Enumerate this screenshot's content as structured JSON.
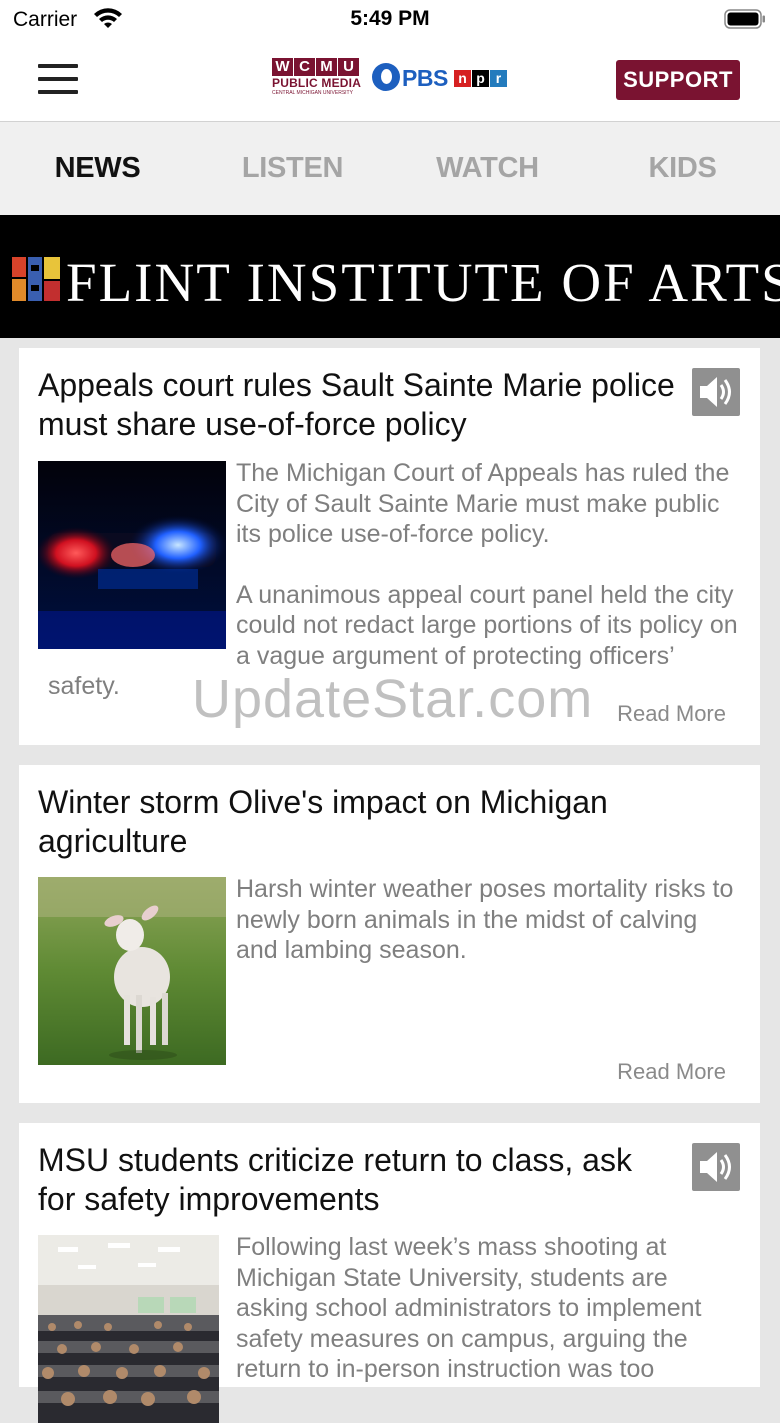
{
  "status_bar": {
    "carrier": "Carrier",
    "time": "5:49 PM"
  },
  "header": {
    "wcmu_letters": [
      "W",
      "C",
      "M",
      "U"
    ],
    "wcmu_public_media": "PUBLIC MEDIA",
    "wcmu_subtitle": "CENTRAL MICHIGAN UNIVERSITY",
    "pbs": "PBS",
    "npr_letters": [
      "n",
      "p",
      "r"
    ],
    "npr_colors": [
      "#d62021",
      "#000000",
      "#237bbd"
    ],
    "support_label": "SUPPORT",
    "brand_color": "#7a1331"
  },
  "tabs": [
    {
      "label": "NEWS",
      "active": true
    },
    {
      "label": "LISTEN",
      "active": false
    },
    {
      "label": "WATCH",
      "active": false
    },
    {
      "label": "KIDS",
      "active": false
    }
  ],
  "banner": {
    "text": "FLINT INSTITUTE OF ARTS"
  },
  "articles": [
    {
      "title": "Appeals court rules Sault Sainte Marie police must share use-of-force policy",
      "summary_p1": "The Michigan Court of Appeals has ruled the City of Sault Sainte Marie must make public its police use-of-force policy.",
      "summary_p2": "A unanimous appeal court panel held the city could not redact large portions of its policy on a vague argument of protecting officers’ safety.",
      "read_more": "Read More",
      "has_audio": true,
      "image": "police-lights-image"
    },
    {
      "title": "Winter storm Olive's impact on Michigan agriculture",
      "summary_p1": "Harsh winter weather poses mortality risks to newly born animals in the midst of calving and lambing season.",
      "read_more": "Read More",
      "has_audio": false,
      "image": "lamb-image"
    },
    {
      "title": "MSU students criticize return to class, ask for safety improvements",
      "summary_p1": "Following last week’s mass shooting at Michigan State University, students are asking school administrators to implement safety measures on campus, arguing the return to in-person instruction was too",
      "has_audio": true,
      "image": "lecture-hall-image"
    }
  ],
  "watermark": "UpdateStar.com"
}
